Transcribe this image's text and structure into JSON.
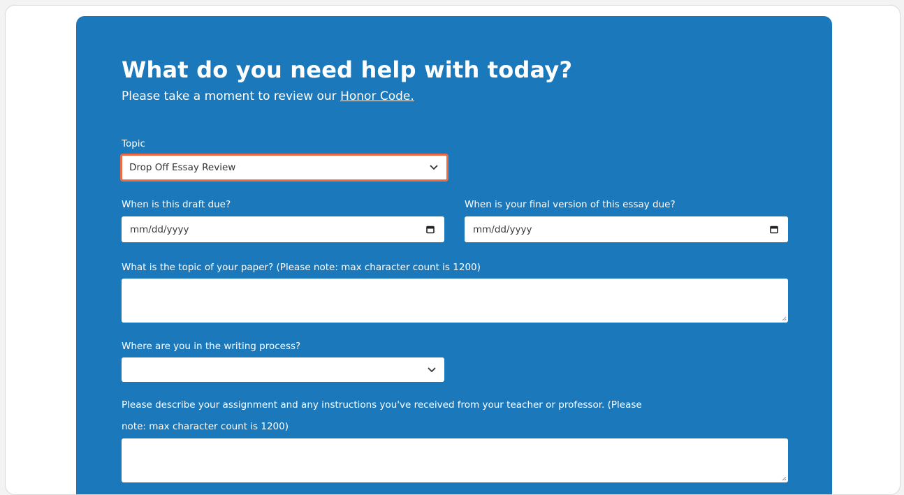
{
  "form": {
    "title": "What do you need help with today?",
    "subtitle_text": "Please take a moment to review our ",
    "honor_code_link": "Honor Code.",
    "topic": {
      "label": "Topic",
      "value": "Drop Off Essay Review"
    },
    "draft_due": {
      "label": "When is this draft due?",
      "placeholder": "mm/dd/yyyy"
    },
    "final_due": {
      "label": "When is your final version of this essay due?",
      "placeholder": "mm/dd/yyyy"
    },
    "paper_topic": {
      "label": "What is the topic of your paper? (Please note: max character count is 1200)",
      "value": ""
    },
    "writing_process": {
      "label": "Where are you in the writing process?",
      "value": ""
    },
    "assignment": {
      "label_line1": "Please describe your assignment and any instructions you've received from your teacher or professor. (Please",
      "label_line2": "note: max character count is 1200)",
      "value": ""
    }
  },
  "colors": {
    "card_background": "#1b79bb",
    "focus_border": "#ec6b45",
    "text_on_card": "#ffffff"
  },
  "icons": [
    "chevron-down-icon",
    "calendar-icon",
    "resize-grip-icon"
  ]
}
